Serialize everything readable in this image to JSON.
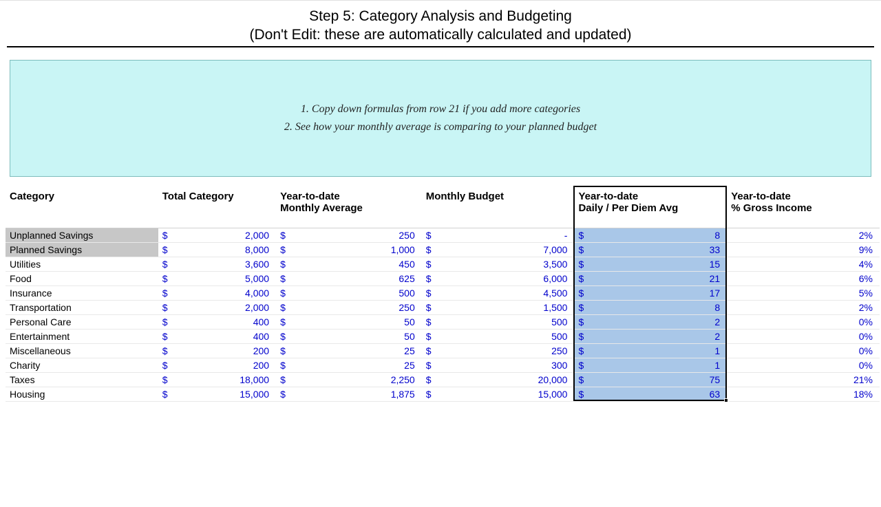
{
  "title": {
    "line1": "Step 5: Category Analysis and Budgeting",
    "line2": "(Don't Edit: these are automatically calculated and updated)"
  },
  "infobox": {
    "line1": "1. Copy down formulas from row 21 if you add more categories",
    "line2": "2. See how your monthly average is comparing to your planned budget"
  },
  "headers": {
    "category": "Category",
    "total": "Total Category",
    "ytd_monthly_avg_l1": "Year-to-date",
    "ytd_monthly_avg_l2": "Monthly Average",
    "monthly_budget": "Monthly Budget",
    "ytd_daily_l1": "Year-to-date",
    "ytd_daily_l2": "Daily / Per Diem Avg",
    "ytd_pct_l1": "Year-to-date",
    "ytd_pct_l2": "% Gross Income"
  },
  "currency_symbol": "$",
  "rows": [
    {
      "shaded": true,
      "category": "Unplanned Savings",
      "total": "2,000",
      "ytd_ma": "250",
      "budget": "-",
      "daily": "8",
      "pct": "2%"
    },
    {
      "shaded": true,
      "category": "Planned Savings",
      "total": "8,000",
      "ytd_ma": "1,000",
      "budget": "7,000",
      "daily": "33",
      "pct": "9%"
    },
    {
      "shaded": false,
      "category": "Utilities",
      "total": "3,600",
      "ytd_ma": "450",
      "budget": "3,500",
      "daily": "15",
      "pct": "4%"
    },
    {
      "shaded": false,
      "category": "Food",
      "total": "5,000",
      "ytd_ma": "625",
      "budget": "6,000",
      "daily": "21",
      "pct": "6%"
    },
    {
      "shaded": false,
      "category": "Insurance",
      "total": "4,000",
      "ytd_ma": "500",
      "budget": "4,500",
      "daily": "17",
      "pct": "5%"
    },
    {
      "shaded": false,
      "category": "Transportation",
      "total": "2,000",
      "ytd_ma": "250",
      "budget": "1,500",
      "daily": "8",
      "pct": "2%"
    },
    {
      "shaded": false,
      "category": "Personal Care",
      "total": "400",
      "ytd_ma": "50",
      "budget": "500",
      "daily": "2",
      "pct": "0%"
    },
    {
      "shaded": false,
      "category": "Entertainment",
      "total": "400",
      "ytd_ma": "50",
      "budget": "500",
      "daily": "2",
      "pct": "0%"
    },
    {
      "shaded": false,
      "category": "Miscellaneous",
      "total": "200",
      "ytd_ma": "25",
      "budget": "250",
      "daily": "1",
      "pct": "0%"
    },
    {
      "shaded": false,
      "category": "Charity",
      "total": "200",
      "ytd_ma": "25",
      "budget": "300",
      "daily": "1",
      "pct": "0%"
    },
    {
      "shaded": false,
      "category": "Taxes",
      "total": "18,000",
      "ytd_ma": "2,250",
      "budget": "20,000",
      "daily": "75",
      "pct": "21%"
    },
    {
      "shaded": false,
      "category": "Housing",
      "total": "15,000",
      "ytd_ma": "1,875",
      "budget": "15,000",
      "daily": "63",
      "pct": "18%"
    }
  ]
}
